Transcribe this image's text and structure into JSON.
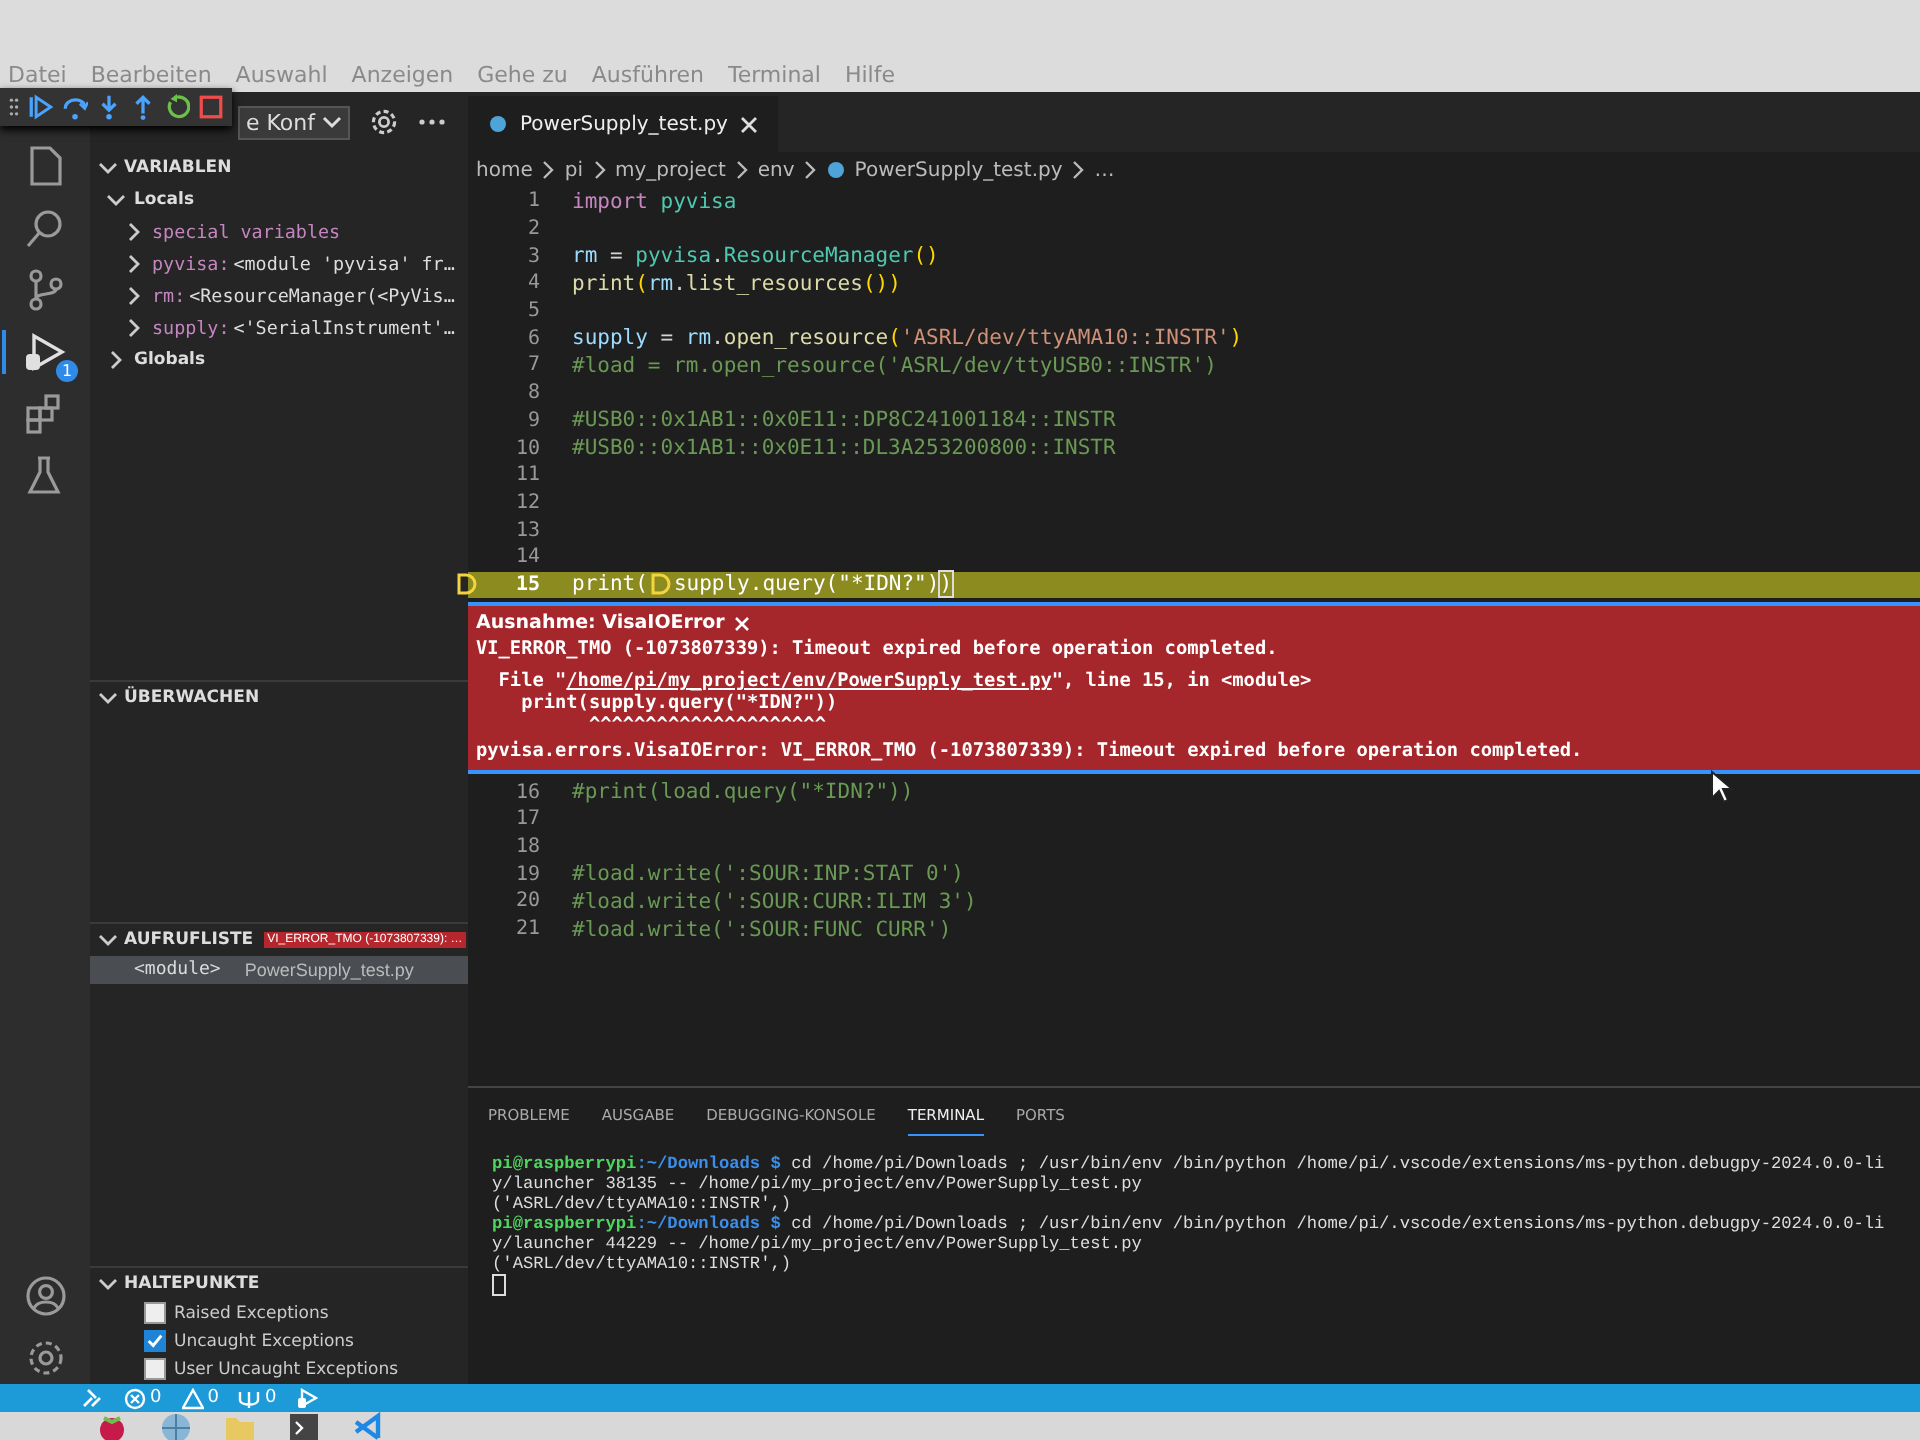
{
  "menu_bar": {
    "items": [
      "Datei",
      "Bearbeiten",
      "Auswahl",
      "Anzeigen",
      "Gehe zu",
      "Ausführen",
      "Terminal",
      "Hilfe"
    ]
  },
  "sidebar": {
    "run_config": "e Konf",
    "variables": {
      "title": "VARIABLEN",
      "expanded": true,
      "items": [
        {
          "name": "Locals",
          "expanded": true,
          "children": [
            {
              "name": "special variables",
              "expanded": false
            },
            {
              "name": "pyvisa:",
              "value": "<module 'pyvisa' fr…",
              "expanded": false
            },
            {
              "name": "rm:",
              "value": "<ResourceManager(<PyVis…",
              "expanded": false
            },
            {
              "name": "supply:",
              "value": "<'SerialInstrument'…",
              "expanded": false
            }
          ]
        },
        {
          "name": "Globals",
          "expanded": false
        }
      ]
    },
    "watch": {
      "title": "ÜBERWACHEN",
      "expanded": true
    },
    "call_stack": {
      "title": "AUFRUFLISTE",
      "expanded": true,
      "badge": "VI_ERROR_TMO (-1073807339): …",
      "frames": [
        {
          "name": "<module>",
          "file": "PowerSupply_test.py",
          "selected": true
        }
      ]
    },
    "breakpoints": {
      "title": "HALTEPUNKTE",
      "expanded": true,
      "items": [
        {
          "label": "Raised Exceptions",
          "checked": false
        },
        {
          "label": "Uncaught Exceptions",
          "checked": true
        },
        {
          "label": "User Uncaught Exceptions",
          "checked": false
        }
      ]
    }
  },
  "activity_bar": {
    "debug_badge": "1"
  },
  "editor": {
    "tabs": [
      {
        "label": "PowerSupply_test.py",
        "selected": true
      }
    ],
    "breadcrumbs": [
      {
        "label": "home",
        "kind": "folder"
      },
      {
        "label": "pi",
        "kind": "folder"
      },
      {
        "label": "my_project",
        "kind": "folder"
      },
      {
        "label": "env",
        "kind": "folder"
      },
      {
        "label": "PowerSupply_test.py",
        "kind": "file"
      },
      {
        "label": "…",
        "kind": "symbol"
      }
    ],
    "lines_before": [
      {
        "number": "1",
        "current": false,
        "tokens": [
          {
            "kind": "keyword",
            "text": "import "
          },
          {
            "kind": "module",
            "text": "pyvisa"
          }
        ]
      },
      {
        "number": "2",
        "current": false
      },
      {
        "number": "3",
        "current": false,
        "tokens": [
          {
            "kind": "variable",
            "text": "rm"
          },
          {
            "kind": "plain",
            "text": " = "
          },
          {
            "kind": "module",
            "text": "pyvisa"
          },
          {
            "kind": "plain",
            "text": "."
          },
          {
            "kind": "module",
            "text": "ResourceManager"
          },
          {
            "kind": "paren",
            "text": "()"
          }
        ]
      },
      {
        "number": "4",
        "current": false,
        "tokens": [
          {
            "kind": "func",
            "text": "print"
          },
          {
            "kind": "paren",
            "text": "("
          },
          {
            "kind": "variable",
            "text": "rm"
          },
          {
            "kind": "plain",
            "text": "."
          },
          {
            "kind": "func",
            "text": "list_resources"
          },
          {
            "kind": "paren",
            "text": "())"
          }
        ]
      },
      {
        "number": "5",
        "current": false
      },
      {
        "number": "6",
        "current": false,
        "tokens": [
          {
            "kind": "variable",
            "text": "supply"
          },
          {
            "kind": "plain",
            "text": " = "
          },
          {
            "kind": "variable",
            "text": "rm"
          },
          {
            "kind": "plain",
            "text": "."
          },
          {
            "kind": "func",
            "text": "open_resource"
          },
          {
            "kind": "paren",
            "text": "("
          },
          {
            "kind": "string",
            "text": "'ASRL/dev/ttyAMA10::INSTR'"
          },
          {
            "kind": "paren",
            "text": ")"
          }
        ]
      },
      {
        "number": "7",
        "current": false,
        "tokens": [
          {
            "kind": "comment",
            "text": "#load = rm.open_resource('ASRL/dev/ttyUSB0::INSTR')"
          }
        ]
      },
      {
        "number": "8",
        "current": false
      },
      {
        "number": "9",
        "current": false,
        "tokens": [
          {
            "kind": "comment",
            "text": "#USB0::0x1AB1::0x0E11::DP8C241001184::INSTR"
          }
        ]
      },
      {
        "number": "10",
        "current": false,
        "tokens": [
          {
            "kind": "comment",
            "text": "#USB0::0x1AB1::0x0E11::DL3A253200800::INSTR"
          }
        ]
      },
      {
        "number": "11",
        "current": false
      },
      {
        "number": "12",
        "current": false
      },
      {
        "number": "13",
        "current": false
      },
      {
        "number": "14",
        "current": false
      },
      {
        "number": "15",
        "current": true,
        "tokens": [
          {
            "kind": "func",
            "text": "print("
          },
          {
            "kind": "marker"
          },
          {
            "kind": "func",
            "text": "supply.query(\"*IDN?\")"
          },
          {
            "kind": "bracket",
            "text": ")"
          }
        ]
      }
    ],
    "exception": {
      "title": "Ausnahme: VisaIOError",
      "message": "VI_ERROR_TMO (-1073807339): Timeout expired before operation completed.",
      "file_prefix": "  File \"",
      "file_link": "/home/pi/my_project/env/PowerSupply_test.py",
      "file_suffix": "\", line 15, in <module>",
      "trace_lines": [
        "    print(supply.query(\"*IDN?\"))",
        "          ^^^^^^^^^^^^^^^^^^^^^"
      ],
      "error_line": "pyvisa.errors.VisaIOError: VI_ERROR_TMO (-1073807339): Timeout expired before operation completed."
    },
    "lines_after": [
      {
        "number": "16",
        "current": false,
        "tokens": [
          {
            "kind": "comment",
            "text": "#print(load.query(\"*IDN?\"))"
          }
        ]
      },
      {
        "number": "17",
        "current": false
      },
      {
        "number": "18",
        "current": false
      },
      {
        "number": "19",
        "current": false,
        "tokens": [
          {
            "kind": "comment",
            "text": "#load.write(':SOUR:INP:STAT 0')"
          }
        ]
      },
      {
        "number": "20",
        "current": false,
        "tokens": [
          {
            "kind": "comment",
            "text": "#load.write(':SOUR:CURR:ILIM 3')"
          }
        ]
      },
      {
        "number": "21",
        "current": false,
        "tokens": [
          {
            "kind": "comment",
            "text": "#load.write(':SOUR:FUNC CURR')"
          }
        ]
      }
    ]
  },
  "panel": {
    "tabs": [
      {
        "label": "PROBLEME",
        "selected": false
      },
      {
        "label": "AUSGABE",
        "selected": false
      },
      {
        "label": "DEBUGGING-KONSOLE",
        "selected": false
      },
      {
        "label": "TERMINAL",
        "selected": true
      },
      {
        "label": "PORTS",
        "selected": false
      }
    ],
    "terminal_lines": [
      {
        "user": "pi@raspberrypi",
        "path": ":~/Downloads $",
        "text": " cd /home/pi/Downloads ; /usr/bin/env /bin/python /home/pi/.vscode/extensions/ms-python.debugpy-2024.0.0-li"
      },
      {
        "text": "y/launcher 38135 -- /home/pi/my_project/env/PowerSupply_test.py"
      },
      {
        "text": "('ASRL/dev/ttyAMA10::INSTR',)"
      },
      {
        "user": "pi@raspberrypi",
        "path": ":~/Downloads $",
        "text": " cd /home/pi/Downloads ; /usr/bin/env /bin/python /home/pi/.vscode/extensions/ms-python.debugpy-2024.0.0-li"
      },
      {
        "text": "y/launcher 44229 -- /home/pi/my_project/env/PowerSupply_test.py"
      },
      {
        "text": "('ASRL/dev/ttyAMA10::INSTR',)"
      }
    ]
  },
  "status_bar": {
    "items": [
      {
        "kind": "errors",
        "text": "0"
      },
      {
        "kind": "warnings",
        "text": "0"
      },
      {
        "kind": "ports",
        "text": "0"
      }
    ]
  }
}
